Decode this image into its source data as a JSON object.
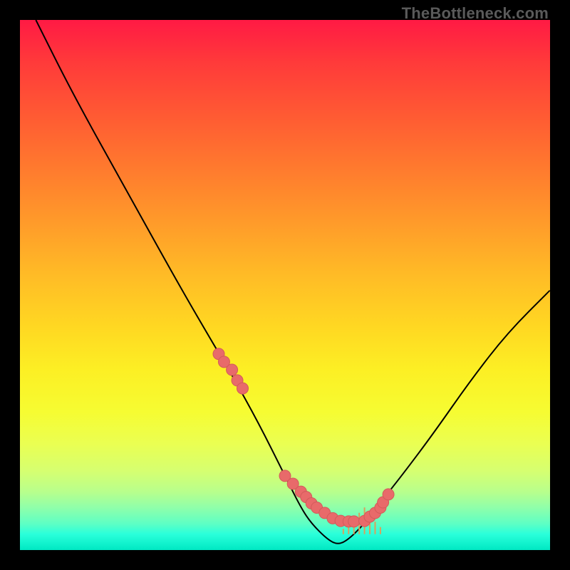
{
  "watermark": "TheBottleneck.com",
  "chart_data": {
    "type": "line",
    "title": "",
    "xlabel": "",
    "ylabel": "",
    "xlim": [
      0,
      100
    ],
    "ylim": [
      0,
      100
    ],
    "x": [
      3,
      10,
      20,
      30,
      37,
      40,
      45,
      50,
      53,
      55,
      58,
      60,
      62,
      65,
      68,
      72,
      78,
      85,
      92,
      100
    ],
    "values": [
      100,
      86,
      68,
      50,
      38,
      33,
      24,
      14,
      8,
      5,
      2,
      1,
      2,
      5,
      9,
      14,
      22,
      32,
      41,
      49
    ],
    "background_gradient": [
      "#ff1a44",
      "#ffd822",
      "#00e8c3"
    ],
    "marker_color": "#e86a6a",
    "marker_x": [
      37.5,
      38.5,
      40,
      41,
      42,
      50,
      51.5,
      53,
      54,
      55,
      56,
      57.5,
      59,
      60.5,
      62,
      63,
      65,
      66,
      67,
      68,
      68.5,
      69.5
    ],
    "marker_y": [
      37,
      35.5,
      34,
      32,
      30.5,
      14,
      12.5,
      11,
      10,
      8.8,
      8,
      7,
      6,
      5.5,
      5.4,
      5.4,
      5.5,
      6.3,
      7,
      8,
      9,
      10.5
    ],
    "tick_x": [
      61,
      62,
      63,
      64,
      65,
      66,
      67,
      68
    ],
    "tick_heights": [
      3,
      5,
      8,
      12,
      15,
      11,
      7,
      4
    ]
  }
}
